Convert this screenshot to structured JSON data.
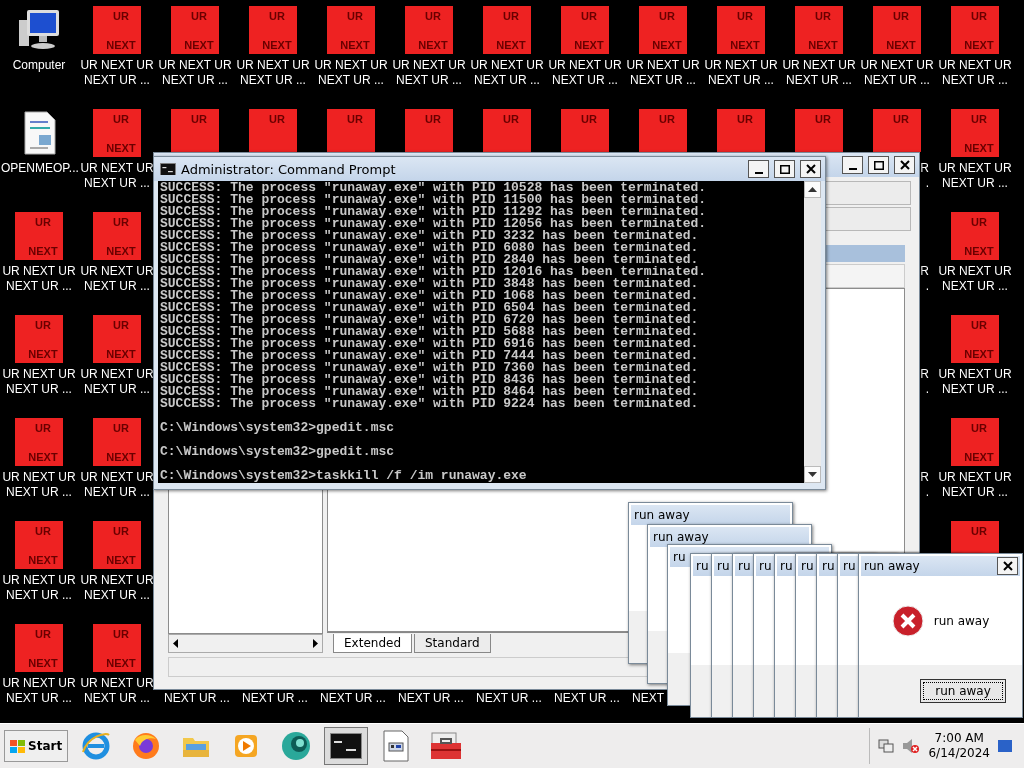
{
  "desktop": {
    "icons": [
      {
        "kind": "computer",
        "label": "Computer"
      },
      {
        "kind": "document",
        "label": "OPENMEOP..."
      },
      {
        "kind": "ur",
        "top": "UR",
        "bottom": "NEXT",
        "label": "UR NEXT UR NEXT UR ..."
      },
      {
        "kind": "ur",
        "top": "UR",
        "bottom": "NEXT",
        "label": "UR NEXT UR NEXT UR ..."
      },
      {
        "kind": "ur",
        "top": "UR",
        "bottom": "NEXT",
        "label": "UR NEXT UR NEXT UR ..."
      },
      {
        "kind": "ur",
        "top": "UR",
        "bottom": "NEXT",
        "label": "UR NEXT UR NEXT UR ..."
      },
      {
        "kind": "ur",
        "top": "UR",
        "bottom": "NEXT",
        "label": "UR NEXT UR NEXT UR ..."
      },
      {
        "kind": "ur",
        "top": "UR",
        "bottom": "NEXT",
        "label": "UR NEXT UR NEXT UR ..."
      },
      {
        "kind": "ur",
        "top": "UR",
        "bottom": "NEXT",
        "label": "UR NEXT UR NEXT UR ..."
      },
      {
        "kind": "ur",
        "top": "UR",
        "bottom": "NEXT",
        "label": "UR NEXT UR NEXT UR ..."
      },
      {
        "kind": "ur",
        "top": "UR",
        "bottom": "NEXT",
        "label": "UR NEXT UR NEXT UR ..."
      },
      {
        "kind": "ur",
        "top": "UR",
        "bottom": "NEXT",
        "label": "UR NEXT UR NEXT UR ..."
      },
      {
        "kind": "ur",
        "top": "UR",
        "bottom": "NEXT",
        "label": "UR NEXT UR NEXT UR ..."
      },
      {
        "kind": "ur",
        "top": "UR",
        "bottom": "NEXT",
        "label": "UR NEXT UR NEXT UR ..."
      },
      {
        "kind": "ur",
        "top": "UR",
        "bottom": "NEXT",
        "label": "UR NEXT UR NEXT UR ..."
      },
      {
        "kind": "ur",
        "top": "UR"
      },
      {
        "kind": "label",
        "line_2": "NEXT UR ..."
      },
      {
        "kind": "ur",
        "top": "UR",
        "bottom": "NEXT",
        "label": "UR NEXT UR NEXT UR ..."
      },
      {
        "kind": "ur",
        "top": "UR"
      },
      {
        "kind": "label",
        "line_2": "NEXT UR ..."
      },
      {
        "kind": "ur",
        "top": "UR",
        "bottom": "NEXT",
        "label": "UR NEXT UR NEXT UR ..."
      },
      {
        "kind": "ur",
        "top": "UR"
      },
      {
        "kind": "label",
        "line_2": "NEXT UR ..."
      },
      {
        "kind": "ur",
        "top": "UR",
        "bottom": "NEXT",
        "label": "UR NEXT UR NEXT UR ..."
      },
      {
        "kind": "ur",
        "top": "UR"
      },
      {
        "kind": "label",
        "line_2": "NEXT UR ..."
      },
      {
        "kind": "ur",
        "top": "UR",
        "bottom": "NEXT",
        "label": "UR NEXT UR NEXT UR ..."
      },
      {
        "kind": "ur",
        "top": "UR"
      },
      {
        "kind": "label",
        "line_2": "NEXT UR ..."
      },
      {
        "kind": "ur",
        "top": "UR",
        "bottom": "NEXT",
        "label": "UR NEXT UR NEXT UR ..."
      },
      {
        "kind": "ur",
        "top": "UR"
      },
      {
        "kind": "label",
        "line_2": "NEXT UR ..."
      },
      {
        "kind": "ur",
        "top": "UR",
        "bottom": "NEXT",
        "label": "UR NEXT UR NEXT UR ..."
      },
      {
        "kind": "ur",
        "top": "UR"
      },
      {
        "kind": "label",
        "line_2": "NEXT"
      },
      {
        "kind": "ur",
        "top": "UR",
        "bottom": "NEXT",
        "label": "UR NEXT UR NEXT UR ..."
      },
      {
        "kind": "ur",
        "top": "UR"
      },
      {
        "kind": "ur",
        "top": "UR",
        "bottom": "NEXT",
        "label": "UR NEXT UR NEXT UR ..."
      },
      {
        "kind": "ur",
        "top": "UR"
      },
      {
        "kind": "ur",
        "top": "UR",
        "bottom": "NEXT",
        "label": "UR NEXT UR NEXT UR ..."
      },
      {
        "kind": "ur",
        "top": "UR",
        "line_1": "R",
        "line_2": "."
      },
      {
        "kind": "label",
        "line_1": "R",
        "line_2": "."
      },
      {
        "kind": "label",
        "line_1": "R",
        "line_2": "."
      },
      {
        "kind": "label",
        "line_1": "R",
        "line_2": "."
      },
      {
        "kind": "ur",
        "top": "UR",
        "bottom": "NEXT",
        "label": "UR NEXT UR NEXT UR ..."
      },
      {
        "kind": "ur",
        "top": "UR",
        "bottom": "NEXT",
        "label": "UR NEXT UR NEXT UR ..."
      },
      {
        "kind": "ur",
        "top": "UR",
        "bottom": "NEXT",
        "label": "UR NEXT UR NEXT UR ..."
      },
      {
        "kind": "ur",
        "top": "UR",
        "bottom": "NEXT",
        "label": "UR NEXT UR NEXT UR ..."
      },
      {
        "kind": "ur",
        "top": "UR",
        "bottom": "NEXT",
        "label": "UR NEXT UR NEXT UR ..."
      },
      {
        "kind": "ur",
        "top": "UR"
      }
    ]
  },
  "mmc_window": {
    "tabs": [
      {
        "label": "Extended",
        "selected": true
      },
      {
        "label": "Standard",
        "selected": false
      }
    ]
  },
  "command_prompt": {
    "title": "Administrator:  Command Prompt",
    "output": [
      "SUCCESS: The process \"runaway.exe\" with PID 10528 has been terminated.",
      "SUCCESS: The process \"runaway.exe\" with PID 11500 has been terminated.",
      "SUCCESS: The process \"runaway.exe\" with PID 11292 has been terminated.",
      "SUCCESS: The process \"runaway.exe\" with PID 12056 has been terminated.",
      "SUCCESS: The process \"runaway.exe\" with PID 3232 has been terminated.",
      "SUCCESS: The process \"runaway.exe\" with PID 6080 has been terminated.",
      "SUCCESS: The process \"runaway.exe\" with PID 2840 has been terminated.",
      "SUCCESS: The process \"runaway.exe\" with PID 12016 has been terminated.",
      "SUCCESS: The process \"runaway.exe\" with PID 3848 has been terminated.",
      "SUCCESS: The process \"runaway.exe\" with PID 1068 has been terminated.",
      "SUCCESS: The process \"runaway.exe\" with PID 6504 has been terminated.",
      "SUCCESS: The process \"runaway.exe\" with PID 6720 has been terminated.",
      "SUCCESS: The process \"runaway.exe\" with PID 5688 has been terminated.",
      "SUCCESS: The process \"runaway.exe\" with PID 6916 has been terminated.",
      "SUCCESS: The process \"runaway.exe\" with PID 7444 has been terminated.",
      "SUCCESS: The process \"runaway.exe\" with PID 7360 has been terminated.",
      "SUCCESS: The process \"runaway.exe\" with PID 8436 has been terminated.",
      "SUCCESS: The process \"runaway.exe\" with PID 8464 has been terminated.",
      "SUCCESS: The process \"runaway.exe\" with PID 9224 has been terminated."
    ],
    "prompts": [
      "C:\\Windows\\system32>gpedit.msc",
      "C:\\Windows\\system32>gpedit.msc",
      "C:\\Windows\\system32>taskkill /f /im runaway.exe"
    ]
  },
  "dialogs": [
    {
      "title": "run away"
    },
    {
      "title": "run away"
    },
    {
      "title": "ru"
    },
    {
      "title": "ru"
    },
    {
      "title": "ru"
    },
    {
      "title": "ru"
    },
    {
      "title": "ru"
    },
    {
      "title": "ru"
    },
    {
      "title": "ru"
    },
    {
      "title": "ru"
    },
    {
      "title": "ru"
    },
    {
      "title": "run away",
      "message": "run away",
      "button": "run away"
    }
  ],
  "taskbar": {
    "start": "Start",
    "apps": [
      {
        "kind": "browser",
        "active": false
      },
      {
        "kind": "firefox",
        "active": false
      },
      {
        "kind": "folder",
        "active": false
      },
      {
        "kind": "media",
        "active": false
      },
      {
        "kind": "sphere",
        "active": false
      },
      {
        "kind": "console",
        "active": true
      },
      {
        "kind": "document",
        "active": false
      },
      {
        "kind": "toolbox",
        "active": false
      }
    ],
    "time": "7:00 AM",
    "date": "6/14/2024"
  }
}
